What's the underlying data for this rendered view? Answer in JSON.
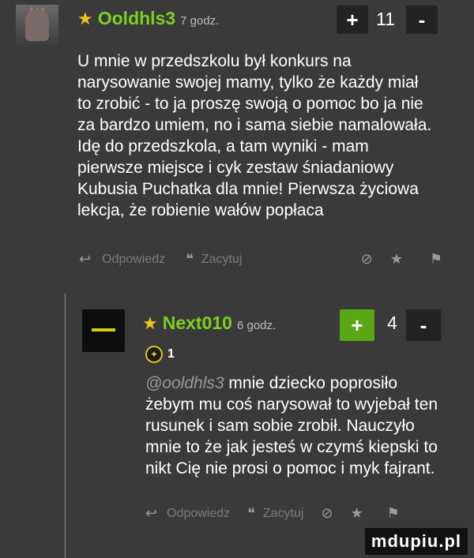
{
  "comment1": {
    "star": "★",
    "username": "Ooldhls3",
    "time": "7 godz.",
    "plus": "+",
    "score": "11",
    "minus": "-",
    "lines": [
      "U mnie w przedszkolu był konkurs na",
      "narysowanie swojej mamy, tylko że każdy miał",
      "to zrobić - to ja proszę swoją o pomoc bo ja nie",
      "za bardzo umiem, no i sama siebie namalowała.",
      "Idę do przedszkola, a tam wyniki - mam",
      "pierwsze miejsce i cyk zestaw śniadaniowy",
      "Kubusia Puchatka dla mnie! Pierwsza życiowa",
      "lekcja, że robienie wałów popłaca"
    ],
    "reply_label": "Odpowiedz",
    "quote_label": "Zacytuj"
  },
  "comment2": {
    "star": "★",
    "username": "Next010",
    "time": "6 godz.",
    "plus": "+",
    "score": "4",
    "minus": "-",
    "badge_count": "1",
    "mention": "@ooldhls3",
    "lines": [
      "mnie dziecko poprosiło",
      "żebym mu coś narysował to wyjebał ten",
      "rusunek i sam sobie zrobił. Nauczyło",
      "mnie to że jak jesteś w czymś kiepski to",
      "nikt Cię nie prosi o pomoc i myk fajrant."
    ],
    "reply_label": "Odpowiedz",
    "quote_label": "Zacytuj"
  },
  "icons": {
    "reply": "↩",
    "quote": "❝",
    "block": "⊘",
    "star": "★",
    "flag": "⚑"
  },
  "watermark": "mdupiu.pl",
  "colors": {
    "background": "#3a3a3a",
    "username": "#7cd01e",
    "star": "#f3c21c",
    "plus_active": "#59a616"
  }
}
